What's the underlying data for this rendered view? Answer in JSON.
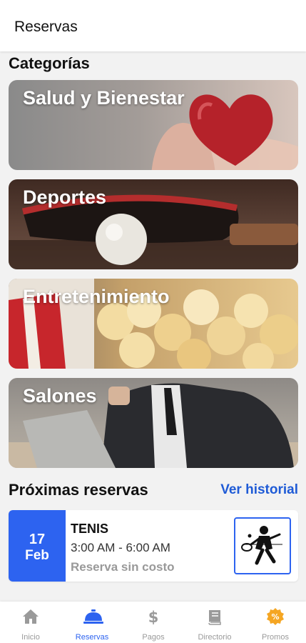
{
  "app_bar": {
    "title": "Reservas"
  },
  "categories": {
    "heading": "Categorías",
    "items": [
      {
        "label": "Salud y Bienestar"
      },
      {
        "label": "Deportes"
      },
      {
        "label": "Entretenimiento"
      },
      {
        "label": "Salones"
      }
    ]
  },
  "upcoming": {
    "heading": "Próximas reservas",
    "history_link": "Ver historial",
    "reservation": {
      "day": "17",
      "month": "Feb",
      "name": "TENIS",
      "time": "3:00 AM - 6:00 AM",
      "cost": "Reserva sin costo",
      "icon": "tennis-player-icon"
    }
  },
  "bottom_nav": {
    "active_index": 1,
    "items": [
      {
        "label": "Inicio",
        "icon": "home-icon"
      },
      {
        "label": "Reservas",
        "icon": "service-bell-icon"
      },
      {
        "label": "Pagos",
        "icon": "dollar-icon"
      },
      {
        "label": "Directorio",
        "icon": "book-icon"
      },
      {
        "label": "Promos",
        "icon": "promo-badge-icon"
      }
    ]
  },
  "colors": {
    "accent": "#2d63f0",
    "link": "#1f5bd6",
    "promo": "#f5a623",
    "inactive": "#9a9a9a"
  }
}
